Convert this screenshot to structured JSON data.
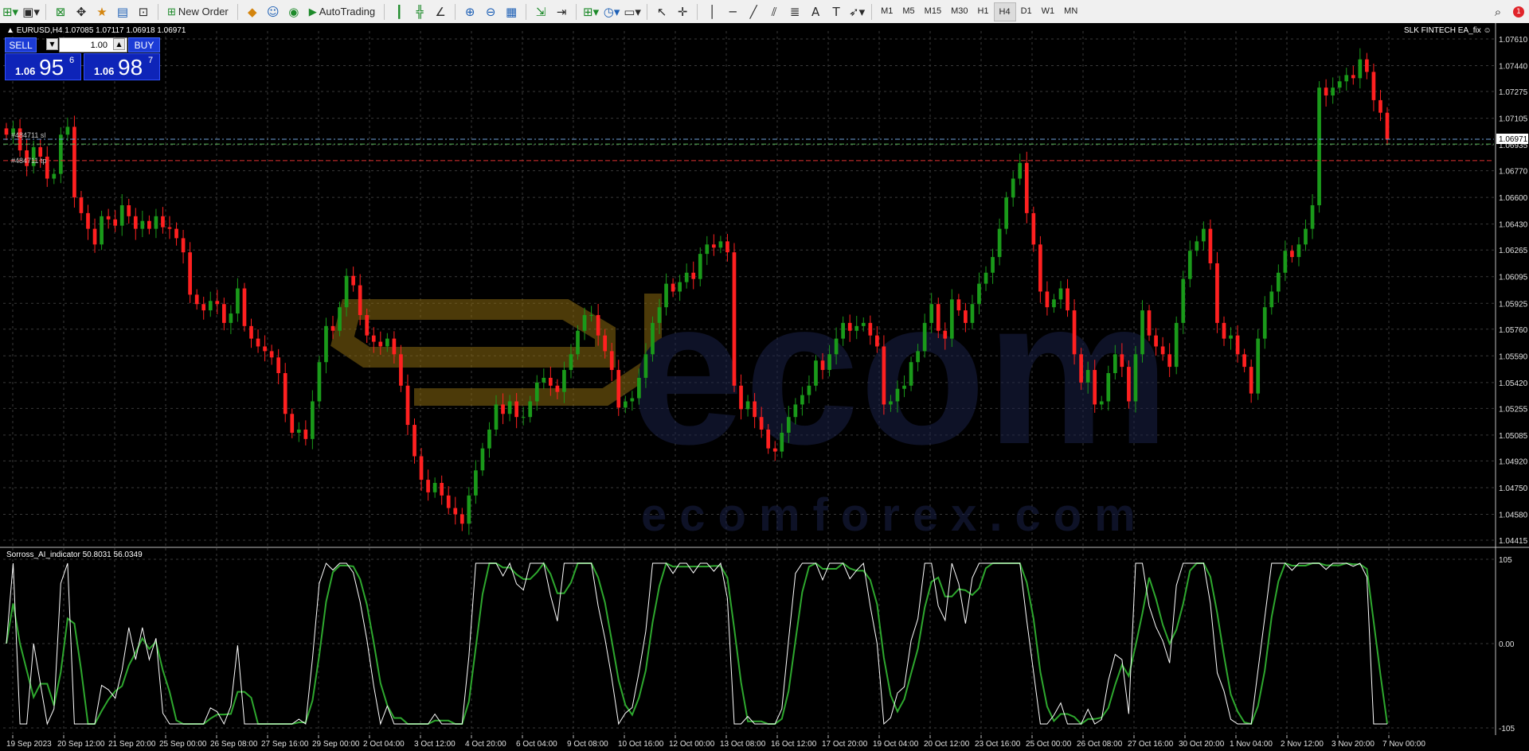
{
  "toolbar": {
    "new_order_label": "New Order",
    "autotrading_label": "AutoTrading",
    "timeframes": [
      "M1",
      "M5",
      "M15",
      "M30",
      "H1",
      "H4",
      "D1",
      "W1",
      "MN"
    ],
    "active_timeframe": "H4",
    "alerts_count": "1"
  },
  "chart": {
    "symbol_header": "EURUSD,H4  1.07085 1.07117 1.06918 1.06971",
    "ea_label": "SLK FINTECH EA_fix",
    "current_price_tag": "1.06971",
    "price_axis": [
      "1.07610",
      "1.07440",
      "1.07275",
      "1.07105",
      "1.06935",
      "1.06770",
      "1.06600",
      "1.06430",
      "1.06265",
      "1.06095",
      "1.05925",
      "1.05760",
      "1.05590",
      "1.05420",
      "1.05255",
      "1.05085",
      "1.04920",
      "1.04750",
      "1.04580",
      "1.04415"
    ],
    "price_min": 1.04415,
    "price_max": 1.0761,
    "line_labels": [
      "#484711 sl",
      "#484711 tp"
    ],
    "line_prices": {
      "blue_dash": 1.06971,
      "green_dash": 1.0694,
      "red_dash": 1.06835
    },
    "watermark": {
      "brand": "ecom",
      "url": "ecomforex.com"
    }
  },
  "one_click": {
    "sell_label": "SELL",
    "buy_label": "BUY",
    "lot": "1.00",
    "sell_prefix": "1.06",
    "sell_big": "95",
    "sell_sup": "6",
    "buy_prefix": "1.06",
    "buy_big": "98",
    "buy_sup": "7"
  },
  "indicator": {
    "header": "Sorross_AI_indicator 50.8031 56.0349",
    "axis": [
      "105",
      "0.00",
      "-105"
    ],
    "min": -105,
    "max": 105
  },
  "time_axis": [
    "19 Sep 2023",
    "20 Sep 12:00",
    "21 Sep 20:00",
    "25 Sep 00:00",
    "26 Sep 08:00",
    "27 Sep 16:00",
    "29 Sep 00:00",
    "2 Oct 04:00",
    "3 Oct 12:00",
    "4 Oct 20:00",
    "6 Oct 04:00",
    "9 Oct 08:00",
    "10 Oct 16:00",
    "12 Oct 00:00",
    "13 Oct 08:00",
    "16 Oct 12:00",
    "17 Oct 20:00",
    "19 Oct 04:00",
    "20 Oct 12:00",
    "23 Oct 16:00",
    "25 Oct 00:00",
    "26 Oct 08:00",
    "27 Oct 16:00",
    "30 Oct 20:00",
    "1 Nov 04:00",
    "2 Nov 12:00",
    "3 Nov 20:00",
    "7 Nov 00:00"
  ],
  "colors": {
    "bull": "#1a9a1a",
    "bear": "#ff2020",
    "grid": "#3a3a3a",
    "indicator_main": "#ffffff",
    "indicator_signal": "#2ea82e",
    "oneclick_blue": "#1c3cd6"
  },
  "chart_data": {
    "type": "candlestick",
    "symbol": "EURUSD",
    "timeframe": "H4",
    "close_series": [
      1.07,
      1.0704,
      1.069,
      1.068,
      1.0692,
      1.0686,
      1.0672,
      1.0675,
      1.07,
      1.0705,
      1.066,
      1.065,
      1.064,
      1.063,
      1.0648,
      1.0646,
      1.0642,
      1.0655,
      1.0648,
      1.064,
      1.0645,
      1.064,
      1.0648,
      1.0641,
      1.064,
      1.0634,
      1.0625,
      1.0598,
      1.0592,
      1.0588,
      1.0594,
      1.0592,
      1.058,
      1.0586,
      1.0602,
      1.0578,
      1.057,
      1.0565,
      1.0562,
      1.0558,
      1.0548,
      1.0522,
      1.051,
      1.0512,
      1.0506,
      1.053,
      1.0555,
      1.0578,
      1.0575,
      1.059,
      1.061,
      1.0604,
      1.0585,
      1.0572,
      1.0568,
      1.0565,
      1.057,
      1.056,
      1.054,
      1.0515,
      1.0495,
      1.048,
      1.0472,
      1.0478,
      1.047,
      1.0462,
      1.0458,
      1.0452,
      1.047,
      1.0486,
      1.05,
      1.0512,
      1.0528,
      1.0522,
      1.053,
      1.052,
      1.052,
      1.053,
      1.0542,
      1.0545,
      1.054,
      1.0536,
      1.055,
      1.056,
      1.0575,
      1.0585,
      1.0585,
      1.0572,
      1.0562,
      1.055,
      1.0526,
      1.053,
      1.0532,
      1.0545,
      1.056,
      1.058,
      1.059,
      1.0605,
      1.06,
      1.0606,
      1.0612,
      1.0608,
      1.0624,
      1.063,
      1.0628,
      1.0632,
      1.0625,
      1.054,
      1.0525,
      1.053,
      1.052,
      1.0512,
      1.05,
      1.0498,
      1.051,
      1.052,
      1.0528,
      1.0534,
      1.054,
      1.0556,
      1.055,
      1.056,
      1.057,
      1.058,
      1.0575,
      1.0578,
      1.058,
      1.0572,
      1.0565,
      1.0528,
      1.053,
      1.0538,
      1.054,
      1.0555,
      1.0562,
      1.058,
      1.0592,
      1.0575,
      1.057,
      1.0595,
      1.0588,
      1.058,
      1.0592,
      1.0605,
      1.0612,
      1.0622,
      1.064,
      1.066,
      1.0672,
      1.0682,
      1.065,
      1.063,
      1.06,
      1.059,
      1.0595,
      1.0602,
      1.0588,
      1.056,
      1.0542,
      1.055,
      1.0528,
      1.053,
      1.0548,
      1.056,
      1.0552,
      1.053,
      1.056,
      1.0588,
      1.0572,
      1.0565,
      1.056,
      1.0552,
      1.058,
      1.0608,
      1.0626,
      1.0632,
      1.064,
      1.0618,
      1.058,
      1.057,
      1.0572,
      1.056,
      1.0552,
      1.0535,
      1.057,
      1.059,
      1.06,
      1.0612,
      1.0626,
      1.0622,
      1.063,
      1.064,
      1.0655,
      1.073,
      1.0725,
      1.073,
      1.0734,
      1.0738,
      1.0736,
      1.0748,
      1.074,
      1.0722,
      1.0714,
      1.0697
    ]
  }
}
